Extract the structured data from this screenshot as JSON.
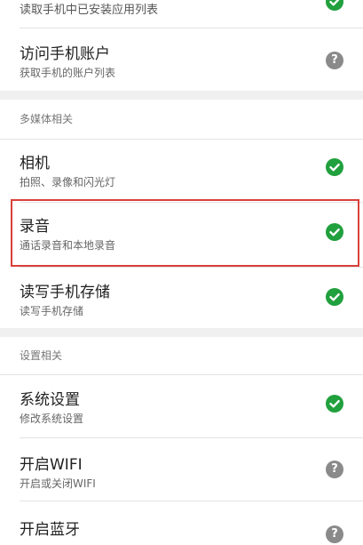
{
  "items": {
    "install_list": {
      "subtitle": "读取手机中已安装应用列表",
      "status": "granted"
    },
    "account": {
      "title": "访问手机账户",
      "subtitle": "获取手机的账户列表",
      "status": "unknown"
    },
    "camera": {
      "title": "相机",
      "subtitle": "拍照、录像和闪光灯",
      "status": "granted"
    },
    "record": {
      "title": "录音",
      "subtitle": "通话录音和本地录音",
      "status": "granted"
    },
    "storage": {
      "title": "读写手机存储",
      "subtitle": "读写手机存储",
      "status": "granted"
    },
    "system_settings": {
      "title": "系统设置",
      "subtitle": "修改系统设置",
      "status": "granted"
    },
    "wifi": {
      "title": "开启WIFI",
      "subtitle": "开启或关闭WIFI",
      "status": "unknown"
    },
    "bluetooth": {
      "title": "开启蓝牙",
      "status": "unknown"
    }
  },
  "sections": {
    "multimedia": "多媒体相关",
    "settings": "设置相关"
  },
  "icons": {
    "granted": "check-circle-icon",
    "unknown": "question-circle-icon"
  },
  "colors": {
    "granted": "#21a03e",
    "unknown": "#8a8a8a",
    "highlight": "#d9403a"
  },
  "help_glyph": "?"
}
